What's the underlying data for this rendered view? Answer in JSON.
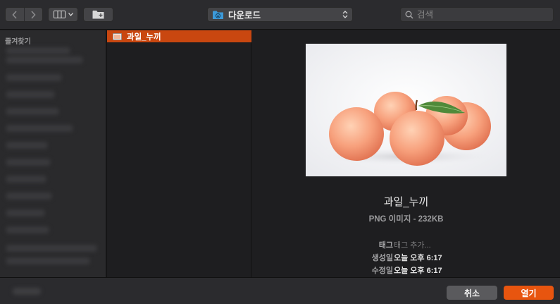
{
  "toolbar": {
    "back_icon": "chevron-left-icon",
    "forward_icon": "chevron-right-icon",
    "view_icon": "column-view-icon",
    "new_folder_icon": "new-folder-icon",
    "location_label": "다운로드",
    "search_placeholder": "검색"
  },
  "sidebar": {
    "title": "즐겨찾기"
  },
  "file_list": {
    "selected_file": "과일_누끼"
  },
  "preview": {
    "name": "과일_누끼",
    "kind": "PNG 이미지 - 232KB",
    "meta": [
      {
        "key": "태그",
        "value": "태그 추가..."
      },
      {
        "key": "생성일",
        "value": "오늘 오후 6:17"
      },
      {
        "key": "수정일",
        "value": "오늘 오후 6:17"
      }
    ]
  },
  "buttons": {
    "cancel": "취소",
    "open": "열기"
  },
  "colors": {
    "accent": "#e8550f",
    "selection": "#c94710"
  }
}
